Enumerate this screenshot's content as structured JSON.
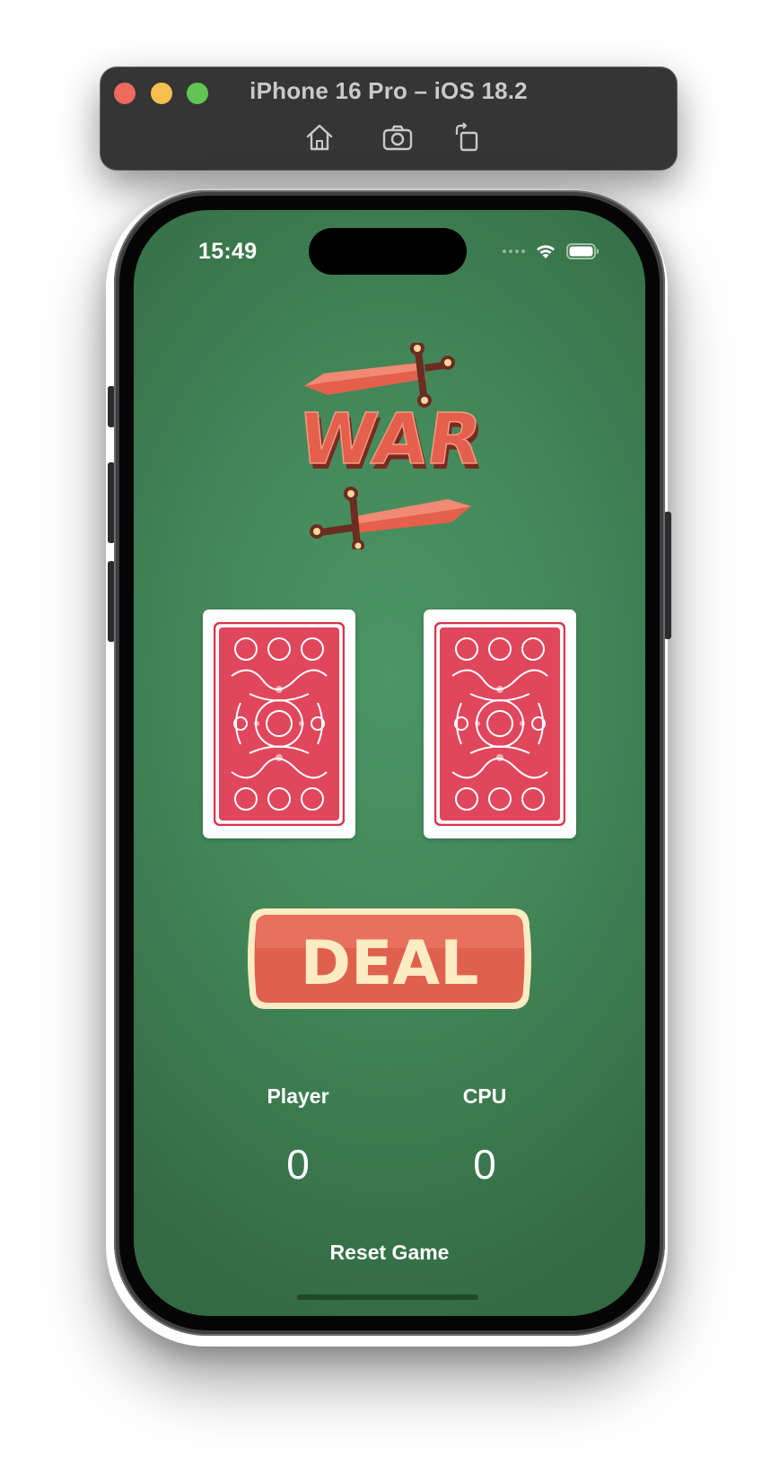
{
  "simulator": {
    "title": "iPhone 16 Pro – iOS 18.2",
    "tools": [
      "home-icon",
      "screenshot-icon",
      "rotate-icon"
    ]
  },
  "status_bar": {
    "time": "15:49",
    "icons": [
      "cellular-dots-icon",
      "wifi-icon",
      "battery-icon"
    ]
  },
  "game": {
    "logo_text": "WAR",
    "deal_label": "DEAL",
    "player_label": "Player",
    "cpu_label": "CPU",
    "player_score": "0",
    "cpu_score": "0",
    "reset_label": "Reset Game"
  },
  "colors": {
    "table_green": "#458e5e",
    "accent_red": "#e0604e",
    "cream": "#fbecc3",
    "card_back_red": "#d8354c"
  }
}
